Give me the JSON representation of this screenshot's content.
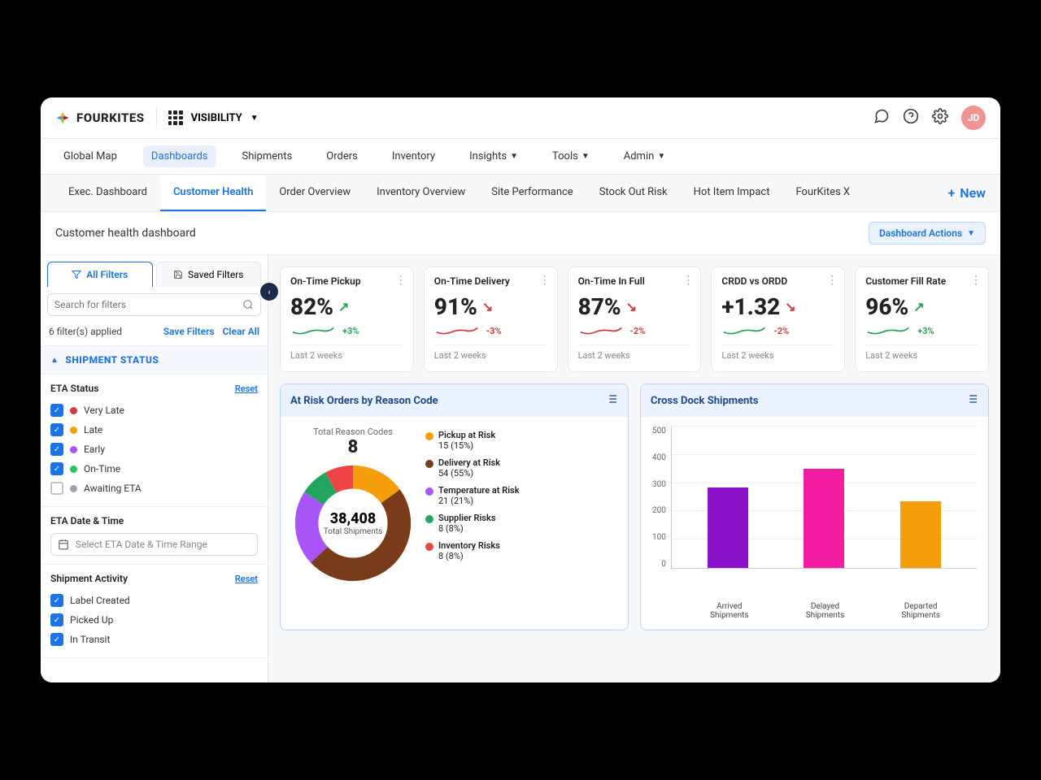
{
  "brand": "FOURKITES",
  "appswitch": "VISIBILITY",
  "topIcons": {
    "avatar": "JD"
  },
  "nav": {
    "items": [
      "Global Map",
      "Dashboards",
      "Shipments",
      "Orders",
      "Inventory",
      "Insights",
      "Tools",
      "Admin"
    ],
    "activeIndex": 1,
    "dropdowns": [
      5,
      6,
      7
    ]
  },
  "subtabs": {
    "items": [
      "Exec. Dashboard",
      "Customer Health",
      "Order Overview",
      "Inventory Overview",
      "Site Performance",
      "Stock Out Risk",
      "Hot Item Impact",
      "FourKites X"
    ],
    "activeIndex": 1,
    "newLabel": "New"
  },
  "pageTitle": "Customer health dashboard",
  "dashboardActions": "Dashboard Actions",
  "sidebar": {
    "tabs": {
      "all": "All Filters",
      "saved": "Saved Filters"
    },
    "searchPlaceholder": "Search for filters",
    "applied": "6 filter(s) applied",
    "save": "Save Filters",
    "clear": "Clear All",
    "sectionTitle": "SHIPMENT STATUS",
    "etaStatus": {
      "title": "ETA Status",
      "reset": "Reset",
      "items": [
        {
          "label": "Very Late",
          "color": "#d63b3b",
          "checked": true
        },
        {
          "label": "Late",
          "color": "#f59e0b",
          "checked": true
        },
        {
          "label": "Early",
          "color": "#a855f7",
          "checked": true
        },
        {
          "label": "On-Time",
          "color": "#22c55e",
          "checked": true
        },
        {
          "label": "Awaiting ETA",
          "color": "#9ca3af",
          "checked": false
        }
      ]
    },
    "etaDate": {
      "title": "ETA Date & Time",
      "placeholder": "Select ETA Date & Time Range"
    },
    "activity": {
      "title": "Shipment Activity",
      "reset": "Reset",
      "items": [
        {
          "label": "Label Created",
          "checked": true
        },
        {
          "label": "Picked Up",
          "checked": true
        },
        {
          "label": "In Transit",
          "checked": true
        }
      ]
    }
  },
  "kpis": [
    {
      "title": "On-Time Pickup",
      "value": "82%",
      "dir": "up",
      "delta": "+3%",
      "period": "Last 2 weeks",
      "sparkColor": "#2aa35a"
    },
    {
      "title": "On-Time Delivery",
      "value": "91%",
      "dir": "down",
      "delta": "-3%",
      "period": "Last 2 weeks",
      "sparkColor": "#d63b3b"
    },
    {
      "title": "On-Time In Full",
      "value": "87%",
      "dir": "down",
      "delta": "-2%",
      "period": "Last 2 weeks",
      "sparkColor": "#d63b3b"
    },
    {
      "title": "CRDD vs ORDD",
      "value": "+1.32",
      "dir": "down",
      "delta": "-2%",
      "period": "Last 2 weeks",
      "sparkColor": "#2aa35a",
      "arrowColor": "#2aa35a"
    },
    {
      "title": "Customer Fill Rate",
      "value": "96%",
      "dir": "up",
      "delta": "+3%",
      "period": "Last 2 weeks",
      "sparkColor": "#2aa35a"
    }
  ],
  "reasonPanel": {
    "title": "At Risk Orders by Reason Code",
    "totalLabel": "Total Reason Codes",
    "total": "8",
    "shipmentsValue": "38,408",
    "shipmentsLabel": "Total Shipments",
    "legend": [
      {
        "label": "Pickup at Risk",
        "value": "15 (15%)",
        "color": "#f59e0b"
      },
      {
        "label": "Delivery at Risk",
        "value": "54 (55%)",
        "color": "#7a3b1b"
      },
      {
        "label": "Temperature at Risk",
        "value": "21 (21%)",
        "color": "#a855f7"
      },
      {
        "label": "Supplier Risks",
        "value": "8 (8%)",
        "color": "#22a55e"
      },
      {
        "label": "Inventory Risks",
        "value": "8 (8%)",
        "color": "#ef4444"
      }
    ]
  },
  "crossDock": {
    "title": "Cross Dock Shipments"
  },
  "chart_data": {
    "type": "bar",
    "categories": [
      "Arrived Shipments",
      "Delayed Shipments",
      "Departed Shipments"
    ],
    "values": [
      285,
      350,
      235
    ],
    "colors": [
      "#8b12c9",
      "#f41ca0",
      "#f59e0b"
    ],
    "y_ticks": [
      0,
      100,
      200,
      300,
      400,
      500
    ],
    "ylim": [
      0,
      500
    ],
    "title": "Cross Dock Shipments",
    "xlabel": "",
    "ylabel": ""
  }
}
